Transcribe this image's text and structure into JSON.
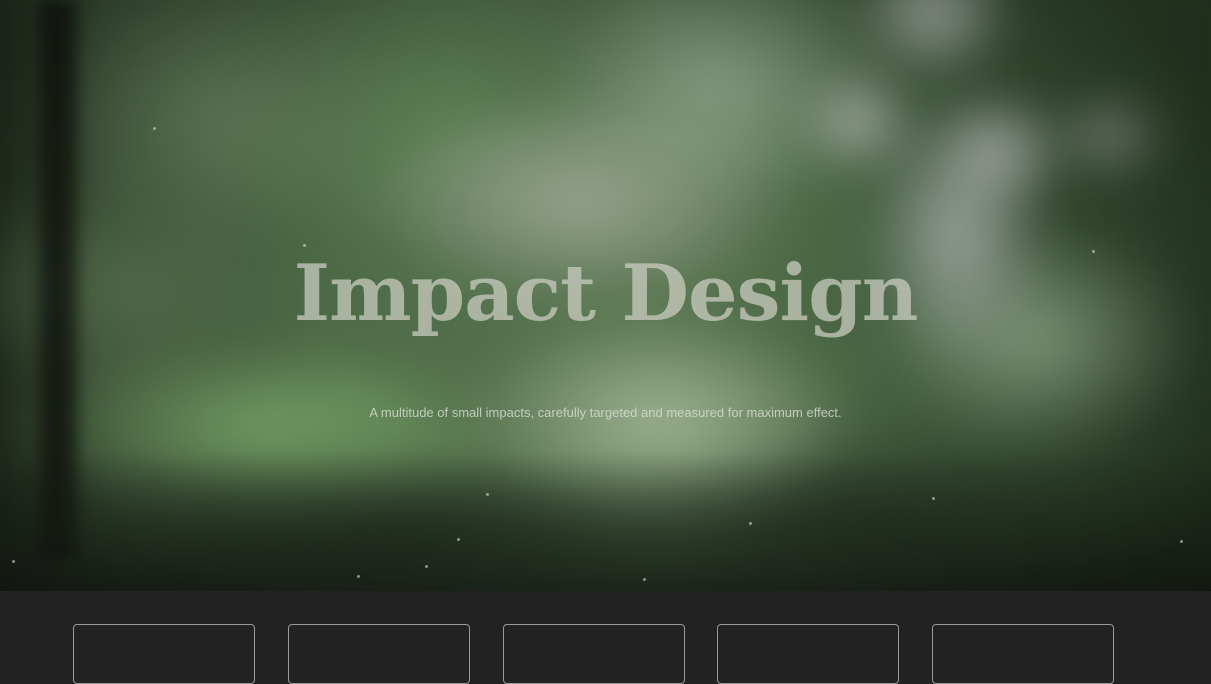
{
  "hero": {
    "title": "Impact Design",
    "subtitle": "A multitude of small impacts, carefully targeted and measured for maximum effect.",
    "background": "blurred-forest-photo"
  },
  "cards": [
    {
      "id": "card-1"
    },
    {
      "id": "card-2"
    },
    {
      "id": "card-3"
    },
    {
      "id": "card-4"
    },
    {
      "id": "card-5"
    }
  ],
  "colors": {
    "page_background": "#222222",
    "card_border": "#9a9a9a",
    "title_text": "#cdd0c4",
    "subtitle_text": "#dee0d8"
  }
}
